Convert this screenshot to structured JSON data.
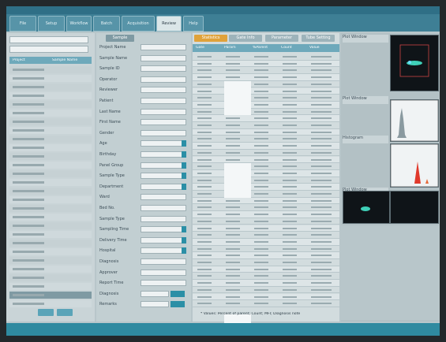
{
  "top_tabs": [
    "File",
    "Setup",
    "Workflow",
    "Batch",
    "Acquisition",
    "Review",
    "Help"
  ],
  "active_tab_index": 5,
  "sidebar": {
    "header": [
      "Project",
      "Sample Name"
    ],
    "row_count": 28
  },
  "form": {
    "header_button": "Sample",
    "fields": [
      {
        "label": "Project Name",
        "value": ""
      },
      {
        "label": "Sample Name",
        "value": ""
      },
      {
        "label": "Sample ID",
        "value": ""
      },
      {
        "label": "Operator",
        "value": ""
      },
      {
        "label": "Reviewer",
        "value": ""
      },
      {
        "label": "Patient",
        "value": ""
      },
      {
        "label": "Last Name",
        "value": ""
      },
      {
        "label": "First Name",
        "value": ""
      },
      {
        "label": "Gender",
        "value": ""
      },
      {
        "label": "Age",
        "value": ""
      },
      {
        "label": "Birthday",
        "value": ""
      },
      {
        "label": "Panel Group",
        "value": ""
      },
      {
        "label": "Sample Type",
        "value": ""
      },
      {
        "label": "Department",
        "value": ""
      },
      {
        "label": "Ward",
        "value": ""
      },
      {
        "label": "Bed No.",
        "value": ""
      },
      {
        "label": "Sample Type",
        "value": ""
      },
      {
        "label": "Sampling Time",
        "value": ""
      },
      {
        "label": "Delivery Time",
        "value": ""
      },
      {
        "label": "Hospital",
        "value": ""
      },
      {
        "label": "Diagnosis",
        "value": ""
      },
      {
        "label": "Approver",
        "value": ""
      },
      {
        "label": "Report Time",
        "value": ""
      },
      {
        "label": "Diagnosis",
        "value": ""
      },
      {
        "label": "Remarks",
        "value": ""
      }
    ]
  },
  "results": {
    "tabs": [
      "Statistics",
      "Gate Info",
      "Parameter",
      "Tube Setting"
    ],
    "columns": [
      "Gate",
      "Param",
      "%Parent",
      "Count",
      "Value"
    ],
    "row_count": 37,
    "footer": "* Values: Percent of parent; Count; MFI; Diagnosis note"
  },
  "viewers": {
    "titles": [
      "Plot Window",
      "Plot Window",
      "Histogram",
      "Plot Window"
    ]
  },
  "colors": {
    "accent": "#3e7f95",
    "table_header": "#6ea9bb",
    "toggle": "#2b8fa6"
  }
}
